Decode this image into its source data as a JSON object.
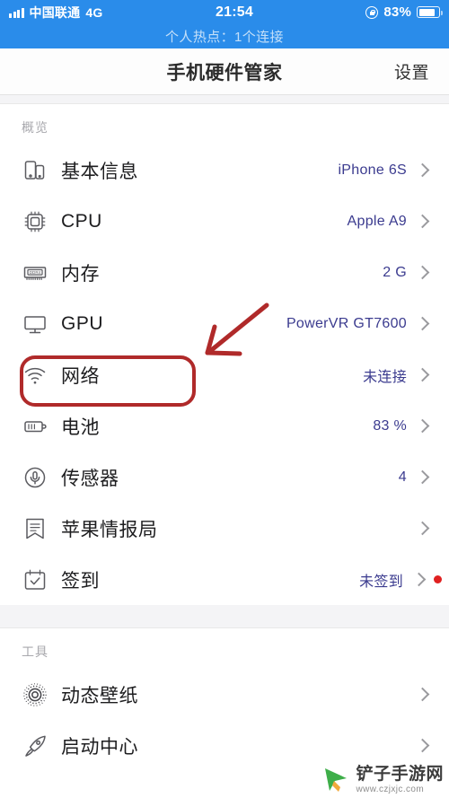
{
  "status_bar": {
    "signal_icon": "signal-bars-icon",
    "carrier": "中国联通",
    "network": "4G",
    "time": "21:54",
    "lock_icon": "rotation-lock-icon",
    "battery_percent": "83%",
    "battery_icon": "battery-icon",
    "battery_level": 83
  },
  "hotspot_banner": {
    "text": "个人热点：1个连接"
  },
  "nav": {
    "title": "手机硬件管家",
    "settings_label": "设置"
  },
  "sections": [
    {
      "title": "概览",
      "rows": [
        {
          "icon": "two-phones-icon",
          "label": "基本信息",
          "value": "iPhone 6S"
        },
        {
          "icon": "cpu-chip-icon",
          "label": "CPU",
          "value": "Apple A9"
        },
        {
          "icon": "ddr4-memory-icon",
          "label": "内存",
          "value": "2 G",
          "highlighted": true
        },
        {
          "icon": "monitor-icon",
          "label": "GPU",
          "value": "PowerVR GT7600"
        },
        {
          "icon": "wifi-icon",
          "label": "网络",
          "value": "未连接"
        },
        {
          "icon": "battery-icon",
          "label": "电池",
          "value": "83 %"
        },
        {
          "icon": "microphone-icon",
          "label": "传感器",
          "value": "4"
        },
        {
          "icon": "bookmark-icon",
          "label": "苹果情报局",
          "value": ""
        },
        {
          "icon": "calendar-check-icon",
          "label": "签到",
          "value": "未签到",
          "badge_dot": true
        }
      ]
    },
    {
      "title": "工具",
      "rows": [
        {
          "icon": "live-wallpaper-icon",
          "label": "动态壁纸",
          "value": ""
        },
        {
          "icon": "rocket-icon",
          "label": "启动中心",
          "value": ""
        }
      ]
    }
  ],
  "annotations": {
    "highlight_box": {
      "target": "内存",
      "color": "#b02a2a"
    },
    "arrow": {
      "points_to": "内存",
      "color": "#b02a2a"
    }
  },
  "watermark": {
    "logo_icon": "cursor-play-logo-icon",
    "site_name": "铲子手游网",
    "url": "www.czjxjc.com"
  }
}
